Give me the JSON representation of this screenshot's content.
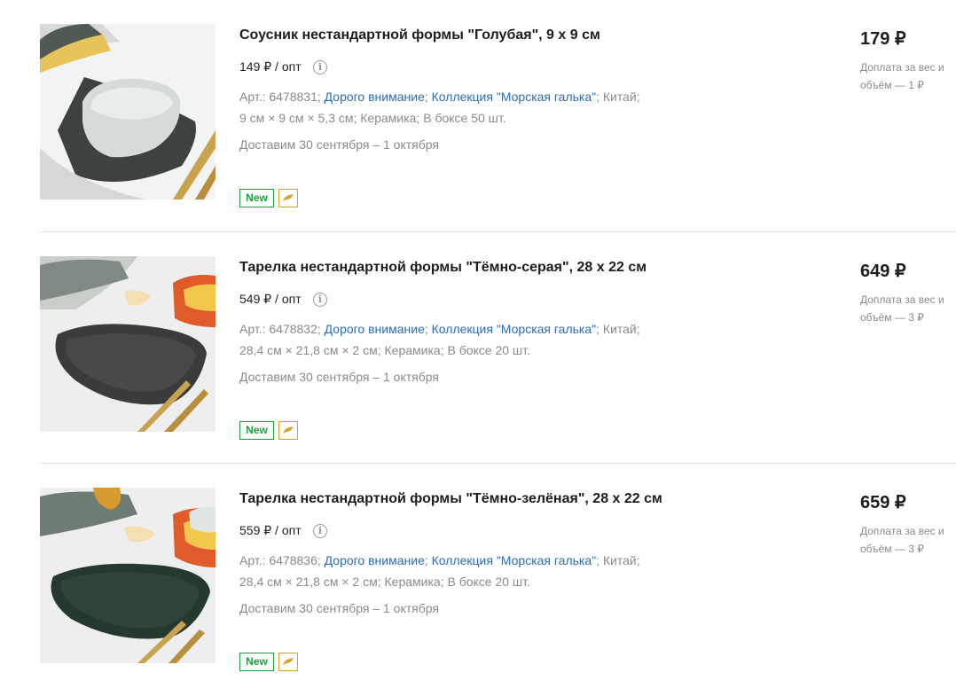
{
  "products": [
    {
      "title": "Соусник нестандартной формы \"Голубая\", 9 х 9 см",
      "wholesale_price": "149 ₽ / опт",
      "article": "Арт.: 6478831;",
      "brand_link": "Дорого внимание",
      "collection_link": "Коллекция \"Морская галька\"",
      "country": "Китай;",
      "specs": "9 см × 9 см × 5,3 см;  Керамика;  В боксе 50 шт.",
      "delivery": "Доставим 30 сентября – 1 октября",
      "badge": "New",
      "price": "179 ₽",
      "surcharge": "Доплата за вес и объём — 1 ₽",
      "image_icon": "ceramic-bowl-photo"
    },
    {
      "title": "Тарелка нестандартной формы \"Тёмно-серая\", 28 х 22 см",
      "wholesale_price": "549 ₽ / опт",
      "article": "Арт.: 6478832;",
      "brand_link": "Дорого внимание",
      "collection_link": "Коллекция \"Морская галька\"",
      "country": "Китай;",
      "specs": "28,4 см × 21,8 см × 2 см;  Керамика;  В боксе 20 шт.",
      "delivery": "Доставим 30 сентября – 1 октября",
      "badge": "New",
      "price": "649 ₽",
      "surcharge": "Доплата за вес и объём — 3 ₽",
      "image_icon": "dark-grey-plate-photo"
    },
    {
      "title": "Тарелка нестандартной формы \"Тёмно-зелёная\", 28 х 22 см",
      "wholesale_price": "559 ₽ / опт",
      "article": "Арт.: 6478836;",
      "brand_link": "Дорого внимание",
      "collection_link": "Коллекция \"Морская галька\"",
      "country": "Китай;",
      "specs": "28,4 см × 21,8 см × 2 см;  Керамика;  В боксе 20 шт.",
      "delivery": "Доставим 30 сентября – 1 октября",
      "badge": "New",
      "price": "659 ₽",
      "surcharge": "Доплата за вес и объём — 3 ₽",
      "image_icon": "dark-green-plate-photo"
    }
  ],
  "colors": {
    "link": "#2c6bb4",
    "badge_new": "#1e9e3e",
    "badge_brand": "#d9a32a",
    "muted_text": "#8a8a8a"
  }
}
